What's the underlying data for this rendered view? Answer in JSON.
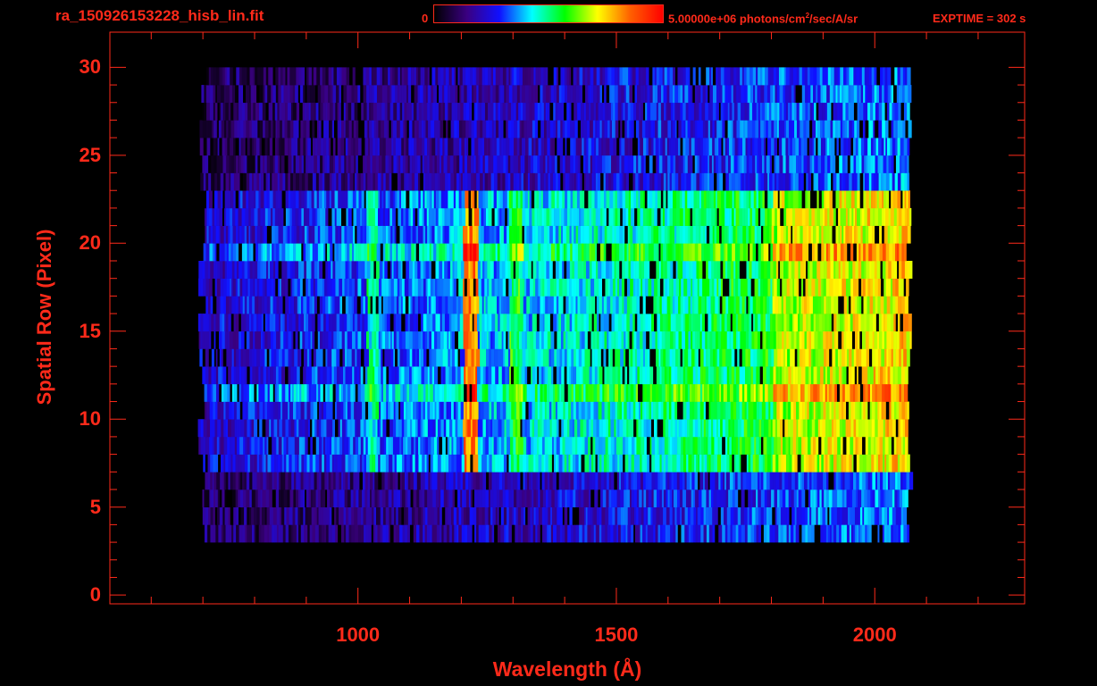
{
  "header": {
    "filename": "ra_150926153228_hisb_lin.fit",
    "colorbar_min": "0",
    "colorbar_max_value": "5.00000e+06 photons/cm",
    "colorbar_max_sup": "2",
    "colorbar_max_rest": "/sec/A/sr",
    "exptime": "EXPTIME = 302 s"
  },
  "colors": {
    "axis": "#ff2a1a",
    "background": "#000000",
    "colormap": [
      "#000000",
      "#3a0080",
      "#1010ff",
      "#00ffff",
      "#00ff00",
      "#ffff00",
      "#ff6000",
      "#ff0000"
    ]
  },
  "chart_data": {
    "type": "heatmap",
    "title": "ra_150926153228_hisb_lin.fit",
    "xlabel": "Wavelength (Å)",
    "ylabel": "Spatial Row (Pixel)",
    "xlim": [
      520,
      2290
    ],
    "ylim": [
      -0.5,
      32
    ],
    "xticks": [
      1000,
      1500,
      2000
    ],
    "xtick_labels": [
      "1000",
      "1500",
      "2000"
    ],
    "yticks": [
      0,
      5,
      10,
      15,
      20,
      25,
      30
    ],
    "ytick_labels": [
      "0",
      "5",
      "10",
      "15",
      "20",
      "25",
      "30"
    ],
    "colorbar": {
      "min": 0,
      "max": 5000000,
      "units": "photons/cm^2/sec/A/sr"
    },
    "exptime_s": 302,
    "rows_illuminated": [
      3,
      30
    ],
    "bright_rows": [
      7,
      23
    ],
    "wavelength_range_A": [
      690,
      2060
    ],
    "emission_features_A": [
      1026,
      1216,
      1304,
      1800
    ],
    "peak_rows": [
      11,
      19
    ]
  }
}
